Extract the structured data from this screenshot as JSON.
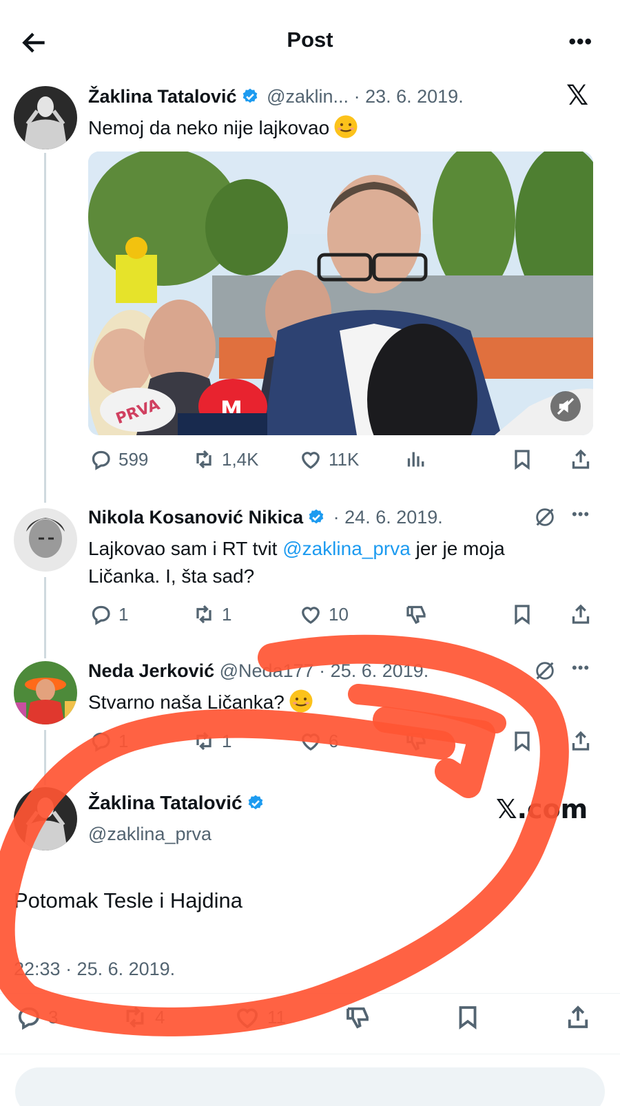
{
  "header": {
    "title": "Post"
  },
  "tweet1": {
    "name": "Žaklina Tatalović",
    "handle": "@zaklin...",
    "separator": "·",
    "date": "23. 6. 2019.",
    "text": "Nemoj da neko nije lajkovao",
    "replies": "599",
    "reposts": "1,4K",
    "likes": "11K",
    "media": {
      "mic_label_left": "PRVA",
      "mic_label_right": "M"
    }
  },
  "tweet2": {
    "name": "Nikola Kosanović Nikica",
    "separator": "·",
    "date": "24. 6. 2019.",
    "text_before": "Lajkovao sam i RT tvit ",
    "mention": "@zaklina_prva",
    "text_after": " jer je moja",
    "text_line2": "Ličanka. I, šta sad?",
    "replies": "1",
    "reposts": "1",
    "likes": "10"
  },
  "tweet3": {
    "name": "Neda Jerković",
    "handle": "@Neda177",
    "separator": "·",
    "date": "25. 6. 2019.",
    "text": "Stvarno naša Ličanka?",
    "replies": "1",
    "reposts": "1",
    "likes": "6"
  },
  "main": {
    "name": "Žaklina Tatalović",
    "handle": "@zaklina_prva",
    "brand": "𝕏.com",
    "text": "Potomak Tesle i Hajdina",
    "timestamp": "22:33 · 25. 6. 2019.",
    "replies": "3",
    "reposts": "4",
    "likes": "11"
  },
  "colors": {
    "verified": "#1d9bf0",
    "mention": "#1d9bf0",
    "scribble": "#ff5533",
    "secondary": "#536471"
  },
  "icons": [
    "back-arrow-icon",
    "more-icon",
    "x-logo-icon",
    "verified-badge-icon",
    "reply-icon",
    "repost-icon",
    "like-icon",
    "views-icon",
    "dislike-icon",
    "bookmark-icon",
    "share-icon",
    "grok-icon",
    "mute-icon",
    "smile-emoji-icon"
  ]
}
